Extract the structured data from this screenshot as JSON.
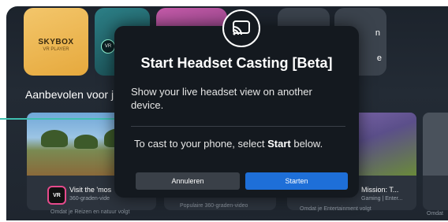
{
  "background": {
    "skybox_title": "SKYBOX",
    "skybox_subtitle": "VR PLAYER",
    "teal_badge": "VR",
    "tile_text_1": "n",
    "tile_text_2": "e",
    "section_title": "Aanbevolen voor j",
    "cards": [
      {
        "badge": "VR",
        "title": "Visit the 'mos",
        "subtitle": "360-graden-vide",
        "footer": "Omdat je Reizen en natuur volgt"
      },
      {
        "footer": "Populaire 360-graden-video"
      },
      {
        "title": "Mission: T...",
        "subtitle": "Gaming | Enter...",
        "footer": "Omdat je Entertainment volgt"
      },
      {
        "footer": "Omdat"
      }
    ]
  },
  "dialog": {
    "icon": "cast-icon",
    "title": "Start Headset Casting [Beta]",
    "description": "Show your live headset view on another device.",
    "instruction_prefix": "To cast to your phone, select ",
    "instruction_bold": "Start",
    "instruction_suffix": " below.",
    "cancel_label": "Annuleren",
    "start_label": "Starten"
  },
  "colors": {
    "accent": "#1e6fd8",
    "callout": "#3fbfb0",
    "dialog_bg": "#14191f"
  }
}
